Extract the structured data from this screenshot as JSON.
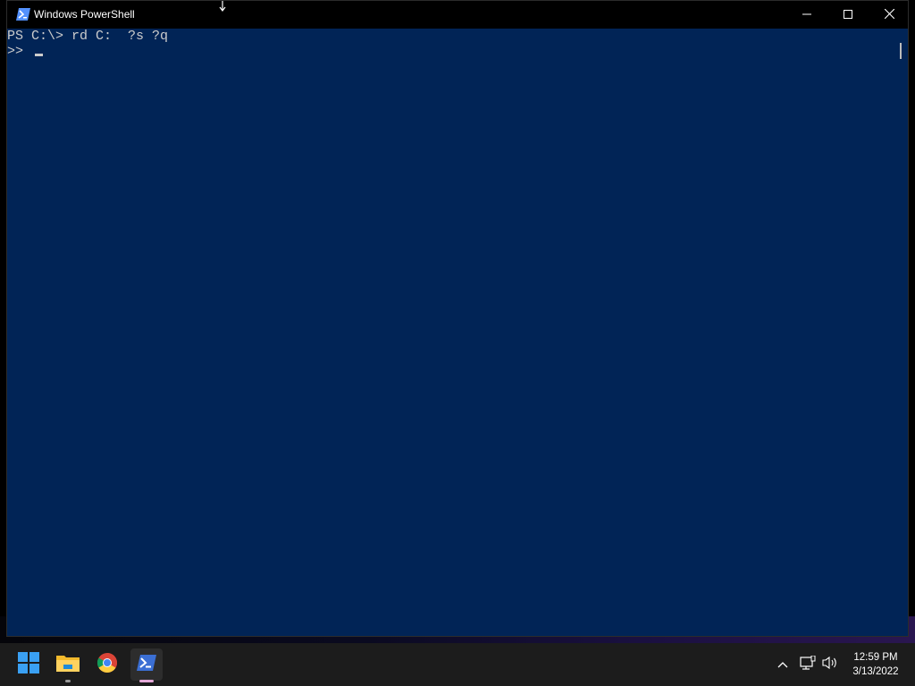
{
  "window": {
    "title": "Windows PowerShell",
    "controls": {
      "minimize_icon": "minimize-icon",
      "maximize_icon": "maximize-icon",
      "close_icon": "close-icon"
    }
  },
  "console": {
    "lines": [
      "PS C:\\> rd C:  ?s ?q",
      ">> "
    ],
    "background_color": "#012456",
    "text_color": "#cccccc"
  },
  "taskbar": {
    "apps": [
      {
        "name": "Start",
        "icon": "windows-logo-icon"
      },
      {
        "name": "File Explorer",
        "icon": "folder-icon"
      },
      {
        "name": "Google Chrome",
        "icon": "chrome-icon"
      },
      {
        "name": "Windows PowerShell",
        "icon": "powershell-icon",
        "active": true
      }
    ],
    "tray": {
      "icons": [
        "chevron-up-icon",
        "network-icon",
        "volume-icon"
      ],
      "time": "12:59 PM",
      "date": "3/13/2022"
    }
  }
}
